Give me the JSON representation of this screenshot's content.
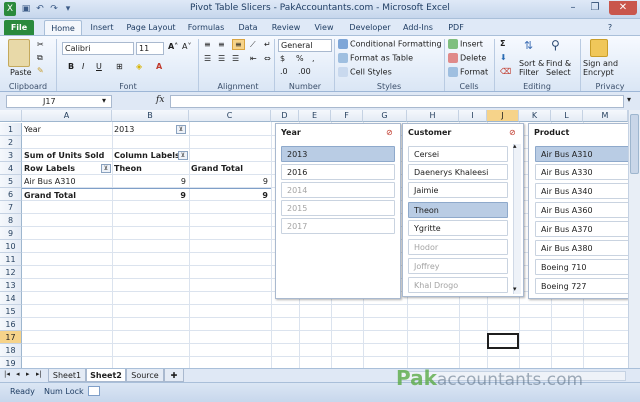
{
  "window": {
    "title": "Pivot Table Slicers - PakAccountants.com  -  Microsoft Excel"
  },
  "ribbon_tabs": [
    "File",
    "Home",
    "Insert",
    "Page Layout",
    "Formulas",
    "Data",
    "Review",
    "View",
    "Developer",
    "Add-Ins",
    "PDF"
  ],
  "ribbon": {
    "font_name": "Calibri",
    "font_size": "11",
    "number_format": "General",
    "paste": "Paste",
    "cond_format": "Conditional Formatting",
    "format_table": "Format as Table",
    "cell_styles": "Cell Styles",
    "insert": "Insert",
    "delete": "Delete",
    "format": "Format",
    "sort_filter": "Sort &",
    "sort_filter2": "Filter",
    "find_select": "Find &",
    "find_select2": "Select",
    "sign_encrypt": "Sign and",
    "sign_encrypt2": "Encrypt",
    "groups": [
      "Clipboard",
      "Font",
      "Alignment",
      "Number",
      "Styles",
      "Cells",
      "Editing",
      "Privacy"
    ]
  },
  "formula_bar": {
    "name_box": "J17",
    "fx": "fx",
    "value": ""
  },
  "columns": [
    "A",
    "B",
    "C",
    "D",
    "E",
    "F",
    "G",
    "H",
    "I",
    "J",
    "K",
    "L",
    "M"
  ],
  "rows": [
    "1",
    "2",
    "3",
    "4",
    "5",
    "6",
    "7",
    "8",
    "9",
    "10",
    "11",
    "12",
    "13",
    "14",
    "15",
    "16",
    "17",
    "18",
    "19"
  ],
  "cells": {
    "A1": "Year",
    "B1": "2013",
    "A3": "Sum of Units Sold",
    "B3": "Column Labels",
    "A4": "Row Labels",
    "B4": "Theon",
    "C4": "Grand Total",
    "A5": "Air Bus A310",
    "B5": "9",
    "C5": "9",
    "A6": "Grand Total",
    "B6": "9",
    "C6": "9"
  },
  "slicers": {
    "year": {
      "title": "Year",
      "items": [
        {
          "label": "2013",
          "state": "on"
        },
        {
          "label": "2016",
          "state": "normal"
        },
        {
          "label": "2014",
          "state": "off"
        },
        {
          "label": "2015",
          "state": "off"
        },
        {
          "label": "2017",
          "state": "off"
        }
      ]
    },
    "customer": {
      "title": "Customer",
      "items": [
        {
          "label": "Cersei",
          "state": "normal"
        },
        {
          "label": "Daenerys Khaleesi",
          "state": "normal"
        },
        {
          "label": "Jaimie",
          "state": "normal"
        },
        {
          "label": "Theon",
          "state": "on"
        },
        {
          "label": "Ygritte",
          "state": "normal"
        },
        {
          "label": "Hodor",
          "state": "off"
        },
        {
          "label": "Joffrey",
          "state": "off"
        },
        {
          "label": "Khal Drogo",
          "state": "off"
        }
      ]
    },
    "product": {
      "title": "Product",
      "items": [
        {
          "label": "Air Bus A310",
          "state": "on"
        },
        {
          "label": "Air Bus A330",
          "state": "normal"
        },
        {
          "label": "Air Bus A340",
          "state": "normal"
        },
        {
          "label": "Air Bus A360",
          "state": "normal"
        },
        {
          "label": "Air Bus A370",
          "state": "normal"
        },
        {
          "label": "Air Bus A380",
          "state": "normal"
        },
        {
          "label": "Boeing 710",
          "state": "normal"
        },
        {
          "label": "Boeing 727",
          "state": "normal"
        }
      ]
    }
  },
  "sheet_tabs": [
    "Sheet1",
    "Sheet2",
    "Source"
  ],
  "active_sheet": "Sheet2",
  "status": {
    "ready": "Ready",
    "numlock": "Num Lock"
  },
  "watermark": {
    "pak": "Pak",
    "rest": "accountants.com"
  },
  "colors": {
    "file_tab": "#2a8a3c",
    "selected_slicer": "#b9cce4",
    "selected_header": "#f6d38a"
  }
}
